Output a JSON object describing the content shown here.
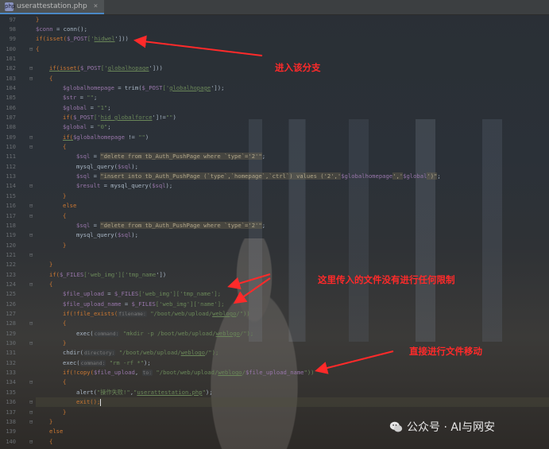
{
  "tab": {
    "icon": "php-file-icon",
    "label": "userattestation.php",
    "close": "×"
  },
  "line_numbers": [
    "97",
    "98",
    "99",
    "100",
    "101",
    "102",
    "103",
    "104",
    "105",
    "106",
    "107",
    "108",
    "109",
    "110",
    "111",
    "112",
    "113",
    "114",
    "115",
    "116",
    "117",
    "118",
    "119",
    "120",
    "121",
    "122",
    "123",
    "124",
    "125",
    "126",
    "127",
    "128",
    "129",
    "130",
    "131",
    "132",
    "133",
    "134",
    "135",
    "136",
    "137",
    "138",
    "139",
    "140"
  ],
  "annotations": {
    "enter_branch": "进入该分支",
    "no_restriction": "这里传入的文件没有进行任何限制",
    "direct_move": "直接进行文件移动"
  },
  "watermark": {
    "text": "公众号 · AI与网安",
    "icon": "wechat-icon"
  },
  "code": {
    "l0": "}",
    "l1a": "$conn",
    "l1b": " = conn();",
    "l2a": "if(isset(",
    "l2b": "$_POST",
    "l2c": "['",
    "l2d": "hidwel",
    "l2e": "']))",
    "l3": "{",
    "l5a": "if(isset(",
    "l5b": "$_POST",
    "l5c": "['",
    "l5d": "globalhopage",
    "l5e": "']))",
    "l6": "{",
    "l7a": "$globalhomepage",
    "l7b": " = trim(",
    "l7c": "$_POST",
    "l7d": "['",
    "l7e": "globalhopage",
    "l7f": "']);",
    "l8a": "$str",
    "l8b": " = ",
    "l8c": "\"\"",
    "l8d": ";",
    "l9a": "$global",
    "l9b": " = ",
    "l9c": "\"1\"",
    "l9d": ";",
    "l10a": "if(",
    "l10b": "$_POST",
    "l10c": "['",
    "l10d": "hid_globalforce",
    "l10e": "']!=",
    "l10f": "\"\"",
    "l10g": ")",
    "l11a": "$global",
    "l11b": " = ",
    "l11c": "\"0\"",
    "l11d": ";",
    "l12a": "if(",
    "l12b": "$globalhomepage",
    "l12c": " != ",
    "l12d": "\"\"",
    "l12e": ")",
    "l13": "{",
    "l14a": "$sql",
    "l14b": " = ",
    "l14c": "\"delete from tb_Auth_PushPage where `type`='2'\"",
    "l14d": ";",
    "l15a": "mysql_query(",
    "l15b": "$sql",
    "l15c": ");",
    "l16a": "$sql",
    "l16b": " = ",
    "l16c": "\"insert into tb_Auth_PushPage (`type`,`homepage`,`ctrl`) values ('2','",
    "l16d": "$globalhomepage",
    "l16e": "','",
    "l16f": "$global",
    "l16g": "')\"",
    "l16h": ";",
    "l17a": "$result",
    "l17b": " = mysql_query(",
    "l17c": "$sql",
    "l17d": ");",
    "l18": "}",
    "l19": "else",
    "l20": "{",
    "l21a": "$sql",
    "l21b": " = ",
    "l21c": "\"delete from tb_Auth_PushPage where `type`='2'\"",
    "l21d": ";",
    "l22a": "mysql_query(",
    "l22b": "$sql",
    "l22c": ");",
    "l23": "}",
    "l25": "}",
    "l26a": "if(",
    "l26b": "$_FILES",
    "l26c": "['",
    "l26d": "web_img",
    "l26e": "']['",
    "l26f": "tmp_name",
    "l26g": "'])",
    "l27": "{",
    "l28a": "$file_upload",
    "l28b": " = ",
    "l28c": "$_FILES",
    "l28d": "['web_img']['tmp_name'];",
    "l29a": "$file_upload_name",
    "l29b": " = ",
    "l29c": "$_FILES",
    "l29d": "['web_img']['name'];",
    "l30a": "if(!file_exists(",
    "l30b": "filename:",
    "l30c": " \"/boot/web/upload/",
    "l30d": "weblogo",
    "l30e": "/\"))",
    "l31": "{",
    "l32a": "exec(",
    "l32b": "command:",
    "l32c": " \"mkdir -p /boot/web/upload/",
    "l32d": "weblogo",
    "l32e": "/\");",
    "l33": "}",
    "l34a": "chdir(",
    "l34b": "directory:",
    "l34c": " \"/boot/web/upload/",
    "l34d": "weblogo",
    "l34e": "/\");",
    "l35a": "exec(",
    "l35b": "command:",
    "l35c": " \"rm -rf *\"",
    "l35d": ");",
    "l36a": "if(!copy(",
    "l36b": "$file_upload",
    "l36c": ", ",
    "l36d": "to:",
    "l36e": " \"/boot/web/upload/",
    "l36f": "weblogo",
    "l36g": "/",
    "l36h": "$file_upload_name",
    "l36i": "\"))",
    "l37": "{",
    "l38a": "alert(",
    "l38b": "\"操作失败!\"",
    "l38c": ",",
    "l38d": "\"",
    "l38e": "userattestation.php",
    "l38f": "\"",
    "l38g": ");",
    "l39": "exit();",
    "l40": "}",
    "l41": "}",
    "l42": "else",
    "l43": "{"
  }
}
